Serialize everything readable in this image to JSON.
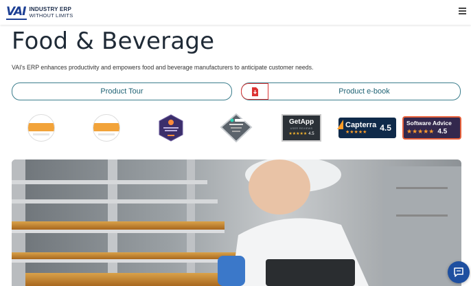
{
  "header": {
    "logo_mark": "VAI",
    "logo_line1": "INDUSTRY ERP",
    "logo_line2": "WITHOUT LIMITS"
  },
  "hero": {
    "title": "Food & Beverage",
    "subtitle": "VAI's ERP enhances productivity and empowers food and beverage manufacturers to anticipate customer needs."
  },
  "buttons": {
    "tour_label": "Product Tour",
    "ebook_label": "Product e-book"
  },
  "badges": {
    "getapp_name": "GetApp",
    "getapp_sub": "USER REVIEWS",
    "getapp_score": "4.5",
    "capterra_name": "Capterra",
    "capterra_score": "4.5",
    "software_advice_name": "Software Advice",
    "software_advice_score": "4.5"
  },
  "colors": {
    "accent": "#3a7d8c",
    "brand": "#1c3f94",
    "pdf_red": "#d33333",
    "chat_blue": "#1e4fa0"
  },
  "icons": [
    "menu-icon",
    "pdf-download-icon",
    "chat-icon"
  ]
}
